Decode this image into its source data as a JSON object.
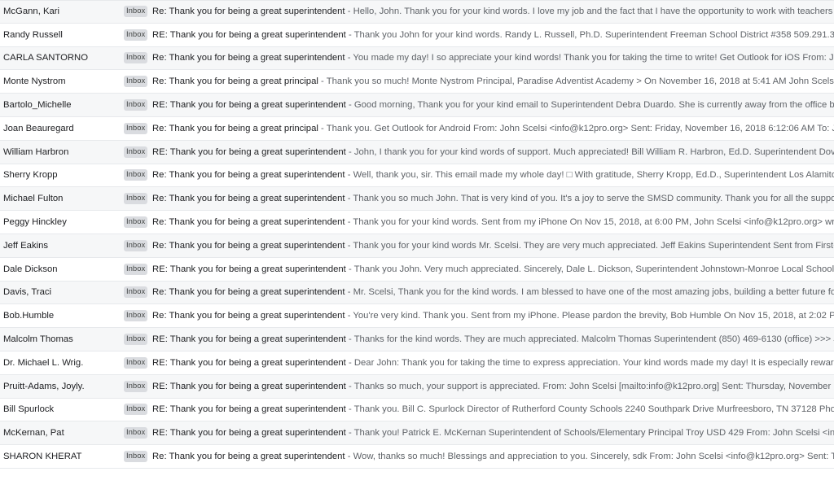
{
  "inbox_label": "Inbox",
  "emails": [
    {
      "sender": "McGann, Kari",
      "subject": "Re: Thank you for being a great superintendent",
      "snippet": " - Hello, John. Thank you for your kind words. I love my job and the fact that I have the opportunity to work with teachers and kids."
    },
    {
      "sender": "Randy Russell",
      "subject": "RE: Thank you for being a great superintendent",
      "snippet": " - Thank you John for your kind words. Randy L. Russell, Ph.D. Superintendent Freeman School District #358 509.291.3695 Go Sc..."
    },
    {
      "sender": "CARLA SANTORNO",
      "subject": "Re: Thank you for being a great superintendent",
      "snippet": " - You made my day! I so appreciate your kind words! Thank you for taking the time to write! Get Outlook for iOS From: John Scels..."
    },
    {
      "sender": "Monte Nystrom",
      "subject": "Re: Thank you for being a great principal",
      "snippet": " - Thank you so much! Monte Nystrom Principal, Paradise Adventist Academy > On November 16, 2018 at 5:41 AM John Scelsi <info@k..."
    },
    {
      "sender": "Bartolo_Michelle",
      "subject": "RE: Thank you for being a great superintendent",
      "snippet": " - Good morning, Thank you for your kind email to Superintendent Debra Duardo. She is currently away from the office but we will ..."
    },
    {
      "sender": "Joan Beauregard",
      "subject": "Re: Thank you for being a great principal",
      "snippet": " - Thank you. Get Outlook for Android From: John Scelsi <info@k12pro.org> Sent: Friday, November 16, 2018 6:12:06 AM To: Joan Beau..."
    },
    {
      "sender": "William Harbron",
      "subject": "RE: Thank you for being a great superintendent",
      "snippet": " - John, I thank you for your kind words of support. Much appreciated! Bill William R. Harbron, Ed.D. Superintendent Dover School ..."
    },
    {
      "sender": "Sherry Kropp",
      "subject": "Re: Thank you for being a great superintendent",
      "snippet": " - Well, thank you, sir. This email made my whole day! □ With gratitude, Sherry Kropp, Ed.D., Superintendent Los Alamitos Unified ..."
    },
    {
      "sender": "Michael Fulton",
      "subject": "Re: Thank you for being a great superintendent",
      "snippet": " - Thank you so much John. That is very kind of you. It's a joy to serve the SMSD community. Thank you for all the support to give..."
    },
    {
      "sender": "Peggy Hinckley",
      "subject": "Re: Thank you for being a great superintendent",
      "snippet": " - Thank you for your kind words. Sent from my iPhone On Nov 15, 2018, at 6:00 PM, John Scelsi <info@k12pro.org> wrote: I woul..."
    },
    {
      "sender": "Jeff Eakins",
      "subject": "Re: Thank you for being a great superintendent",
      "snippet": " - Thank you for your kind words Mr. Scelsi. They are very much appreciated. Jeff Eakins Superintendent Sent from FirstClass wit..."
    },
    {
      "sender": "Dale Dickson",
      "subject": "RE: Thank you for being a great superintendent",
      "snippet": " - Thank you John. Very much appreciated. Sincerely, Dale L. Dickson, Superintendent Johnstown-Monroe Local Schools 441 S. ..."
    },
    {
      "sender": "Davis, Traci",
      "subject": "Re: Thank you for being a great superintendent",
      "snippet": " - Mr. Scelsi, Thank you for the kind words. I am blessed to have one of the most amazing jobs, building a better future for the wo..."
    },
    {
      "sender": "Bob.Humble",
      "subject": "Re: Thank you for being a great superintendent",
      "snippet": " - You're very kind. Thank you. Sent from my iPhone. Please pardon the brevity, Bob Humble On Nov 15, 2018, at 2:02 PM, John S..."
    },
    {
      "sender": "Malcolm Thomas",
      "subject": "RE: Thank you for being a great superintendent",
      "snippet": " - Thanks for the kind words. They are much appreciated. Malcolm Thomas Superintendent (850) 469-6130 (office) >>> John Scel..."
    },
    {
      "sender": "Dr. Michael L. Wrig.",
      "subject": "RE: Thank you for being a great superintendent",
      "snippet": " - Dear John: Thank you for taking the time to express appreciation. Your kind words made my day! It is especially rewarding to b..."
    },
    {
      "sender": "Pruitt-Adams, Joyly.",
      "subject": "RE: Thank you for being a great superintendent",
      "snippet": " - Thanks so much, your support is appreciated. From: John Scelsi [mailto:info@k12pro.org] Sent: Thursday, November 15, 2018 ..."
    },
    {
      "sender": "Bill Spurlock",
      "subject": "RE: Thank you for being a great superintendent",
      "snippet": " - Thank you. Bill C. Spurlock Director of Rutherford County Schools 2240 Southpark Drive Murfreesboro, TN 37128 Phone: 615-8..."
    },
    {
      "sender": "McKernan, Pat",
      "subject": "RE: Thank you for being a great superintendent",
      "snippet": " - Thank you! Patrick E. McKernan Superintendent of Schools/Elementary Principal Troy USD 429 From: John Scelsi <info@k12pr..."
    },
    {
      "sender": "SHARON KHERAT",
      "subject": "Re: Thank you for being a great superintendent",
      "snippet": " - Wow, thanks so much! Blessings and appreciation to you. Sincerely, sdk From: John Scelsi <info@k12pro.org> Sent: Thursday, ..."
    }
  ]
}
